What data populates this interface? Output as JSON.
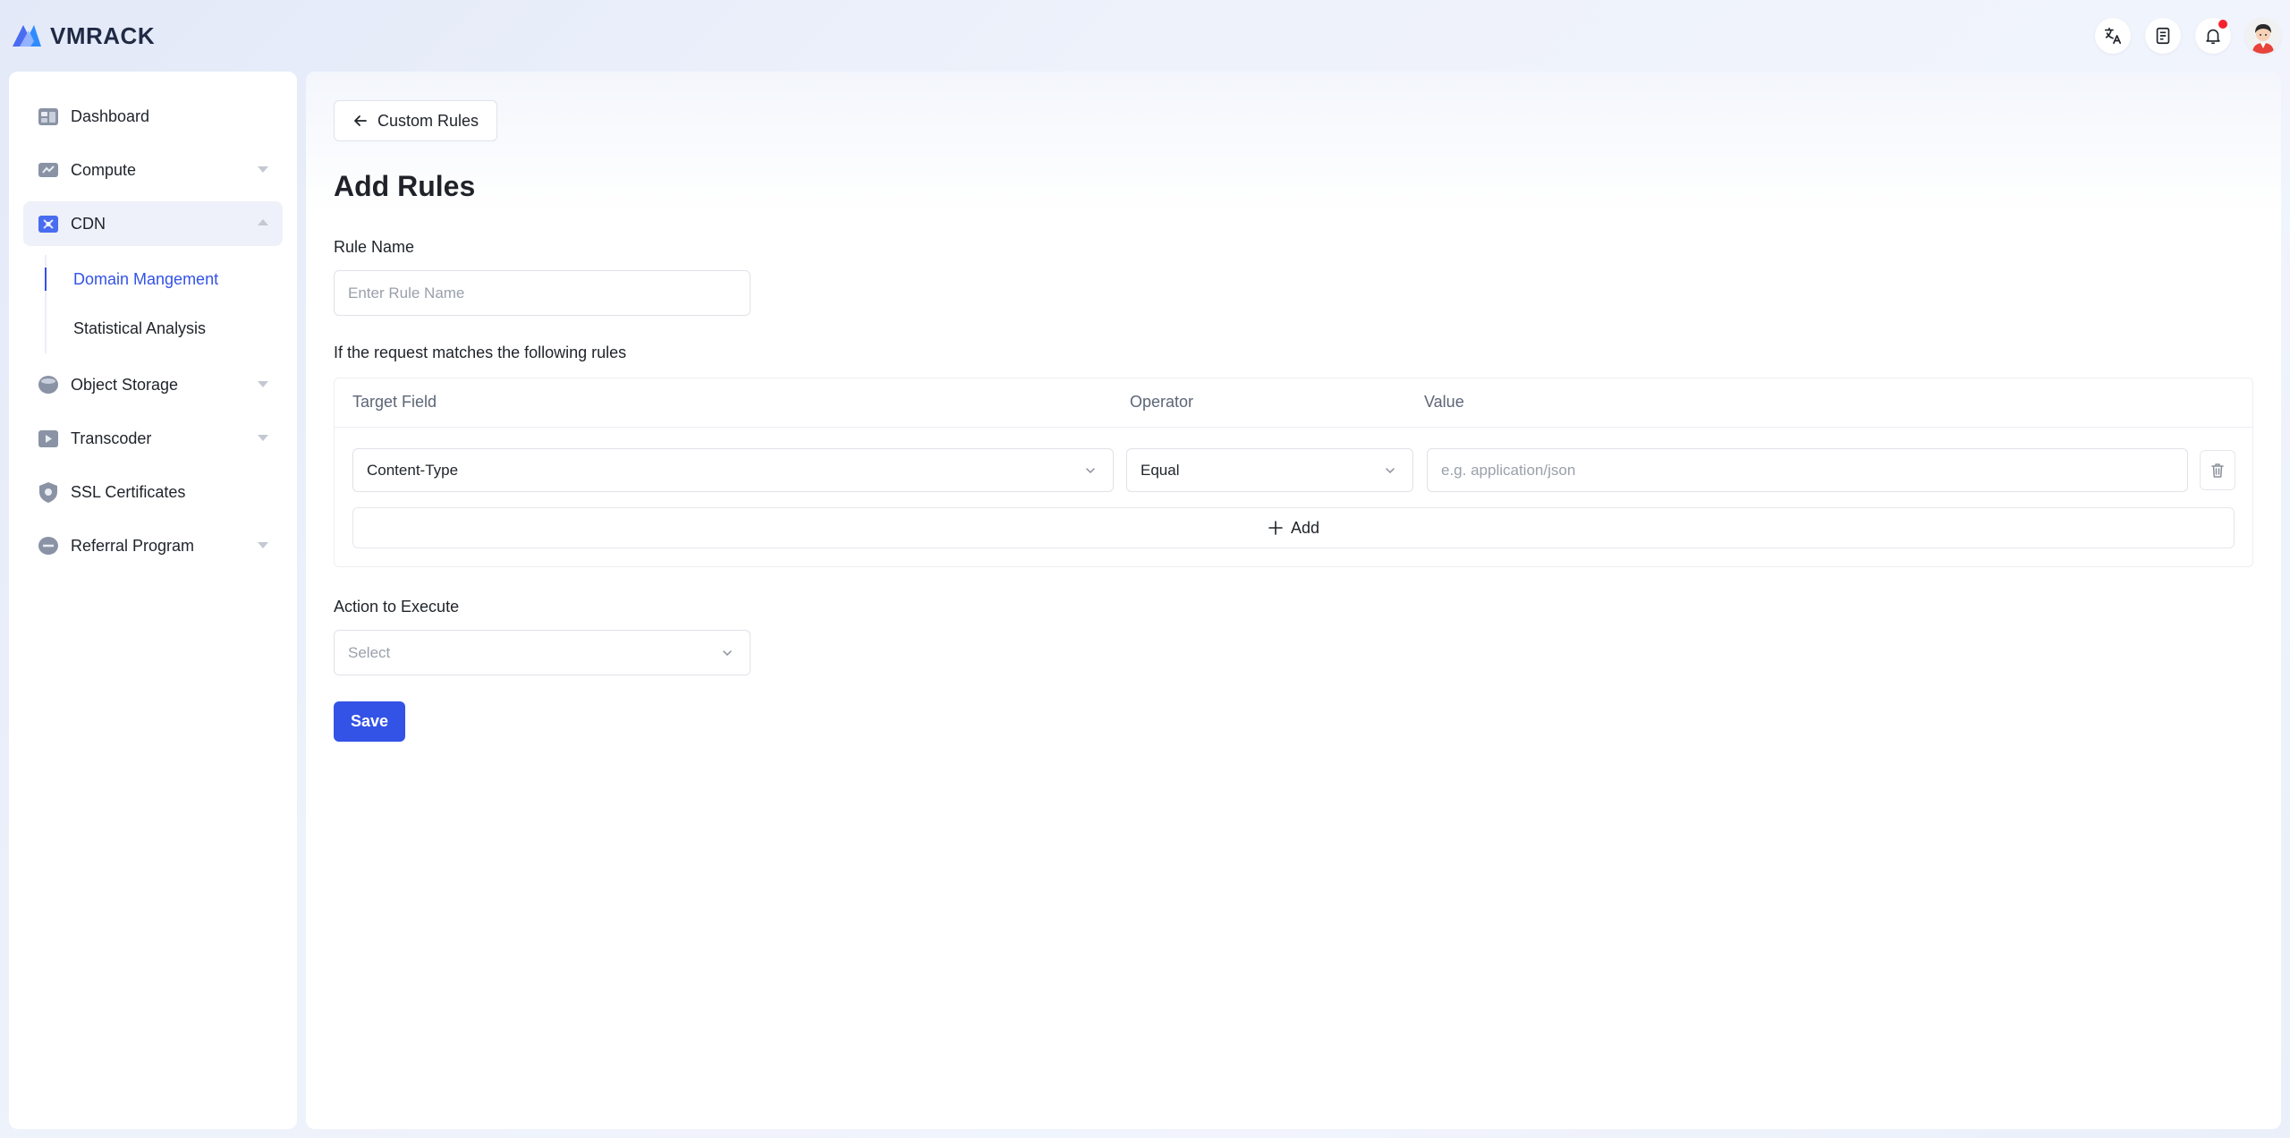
{
  "brand": {
    "name": "VMRACK",
    "accent_color": "#3352e6"
  },
  "header": {
    "icons": [
      "translate-icon",
      "document-icon",
      "bell-icon",
      "avatar"
    ]
  },
  "sidebar": {
    "items": [
      {
        "label": "Dashboard",
        "icon": "dashboard-icon",
        "expandable": false
      },
      {
        "label": "Compute",
        "icon": "compute-icon",
        "expandable": true
      },
      {
        "label": "CDN",
        "icon": "cdn-icon",
        "expandable": true,
        "expanded": true,
        "children": [
          {
            "label": "Domain Mangement",
            "active": true
          },
          {
            "label": "Statistical Analysis",
            "active": false
          }
        ]
      },
      {
        "label": "Object Storage",
        "icon": "storage-icon",
        "expandable": true
      },
      {
        "label": "Transcoder",
        "icon": "transcoder-icon",
        "expandable": true
      },
      {
        "label": "SSL Certificates",
        "icon": "ssl-icon",
        "expandable": false
      },
      {
        "label": "Referral Program",
        "icon": "referral-icon",
        "expandable": true
      }
    ]
  },
  "main": {
    "back_label": "Custom Rules",
    "title": "Add Rules",
    "rule_name": {
      "label": "Rule Name",
      "placeholder": "Enter Rule Name",
      "value": ""
    },
    "match_label": "If the request matches the following rules",
    "rules_table": {
      "headers": {
        "target_field": "Target Field",
        "operator": "Operator",
        "value": "Value"
      },
      "rows": [
        {
          "target_field": "Content-Type",
          "operator": "Equal",
          "value_placeholder": "e.g. application/json",
          "value": ""
        }
      ],
      "add_label": "Add"
    },
    "action": {
      "label": "Action to Execute",
      "placeholder": "Select"
    },
    "save_label": "Save"
  }
}
